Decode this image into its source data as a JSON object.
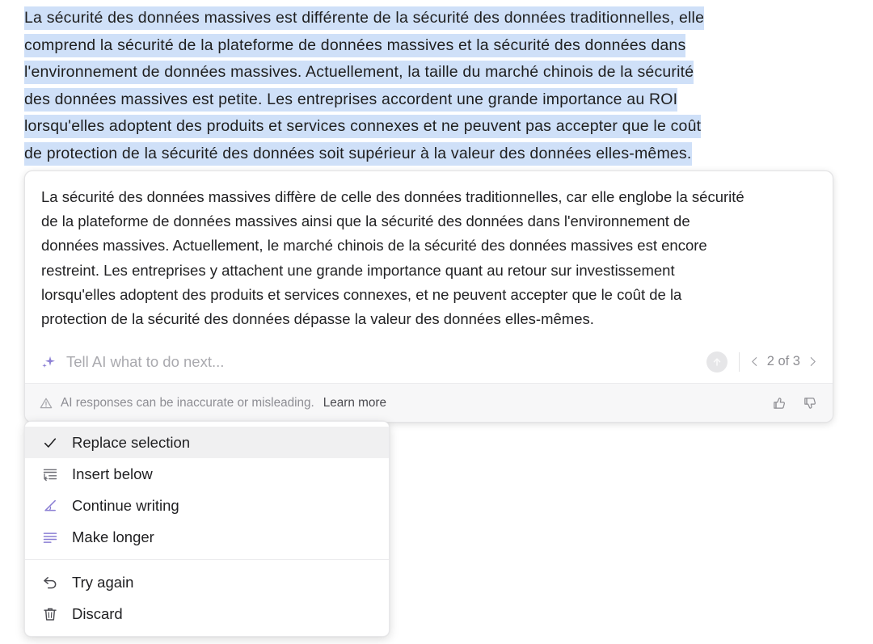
{
  "selection": {
    "highlight_color": "#cfe0f8",
    "lines": [
      "La sécurité des données massives est différente de la sécurité des données traditionnelles, elle",
      "comprend la sécurité de la plateforme de données massives et la sécurité des données dans",
      "l'environnement de données massives. Actuellement, la taille du marché chinois de la sécurité",
      "des données massives est petite. Les entreprises accordent une grande importance au ROI",
      "lorsqu'elles adoptent des produits et services connexes et ne peuvent pas accepter que le coût",
      "de protection de la sécurité des données soit supérieur à la valeur des données elles-mêmes."
    ]
  },
  "ai_card": {
    "response_lines": [
      "La sécurité des données massives diffère de celle des données traditionnelles, car elle englobe la sécurité",
      "de la plateforme de données massives ainsi que la sécurité des données dans l'environnement de",
      "données massives. Actuellement, le marché chinois de la sécurité des données massives est encore",
      "restreint. Les entreprises y attachent une grande importance quant au retour sur investissement",
      "lorsqu'elles adoptent des produits et services connexes, et ne peuvent accepter que le coût de la",
      "protection de la sécurité des données dépasse la valeur des données elles-mêmes."
    ],
    "prompt": {
      "placeholder": "Tell AI what to do next...",
      "value": "",
      "sparkle_icon": "ai-sparkle-icon",
      "submit_icon": "arrow-up-circle-icon"
    },
    "pager": {
      "label": "2 of 3",
      "current": 2,
      "total": 3,
      "prev_icon": "chevron-left-icon",
      "next_icon": "chevron-right-icon"
    },
    "footer": {
      "warning_icon": "warning-triangle-icon",
      "disclaimer": "AI responses can be inaccurate or misleading.",
      "learn_more": "Learn more",
      "thumbs_up_icon": "thumbs-up-icon",
      "thumbs_down_icon": "thumbs-down-icon"
    }
  },
  "action_menu": {
    "group_one": [
      {
        "label": "Replace selection",
        "icon": "check-icon",
        "active": true
      },
      {
        "label": "Insert below",
        "icon": "insert-below-icon",
        "active": false
      },
      {
        "label": "Continue writing",
        "icon": "continue-writing-icon",
        "active": false
      },
      {
        "label": "Make longer",
        "icon": "make-longer-icon",
        "active": false
      }
    ],
    "group_two": [
      {
        "label": "Try again",
        "icon": "undo-arrow-icon",
        "active": false
      },
      {
        "label": "Discard",
        "icon": "trash-icon",
        "active": false
      }
    ]
  },
  "colors": {
    "accent_purple": "#8b7fd4",
    "selection_blue": "#cfe0f8",
    "text_primary": "#1f1f21",
    "text_muted": "#8d8d93"
  }
}
